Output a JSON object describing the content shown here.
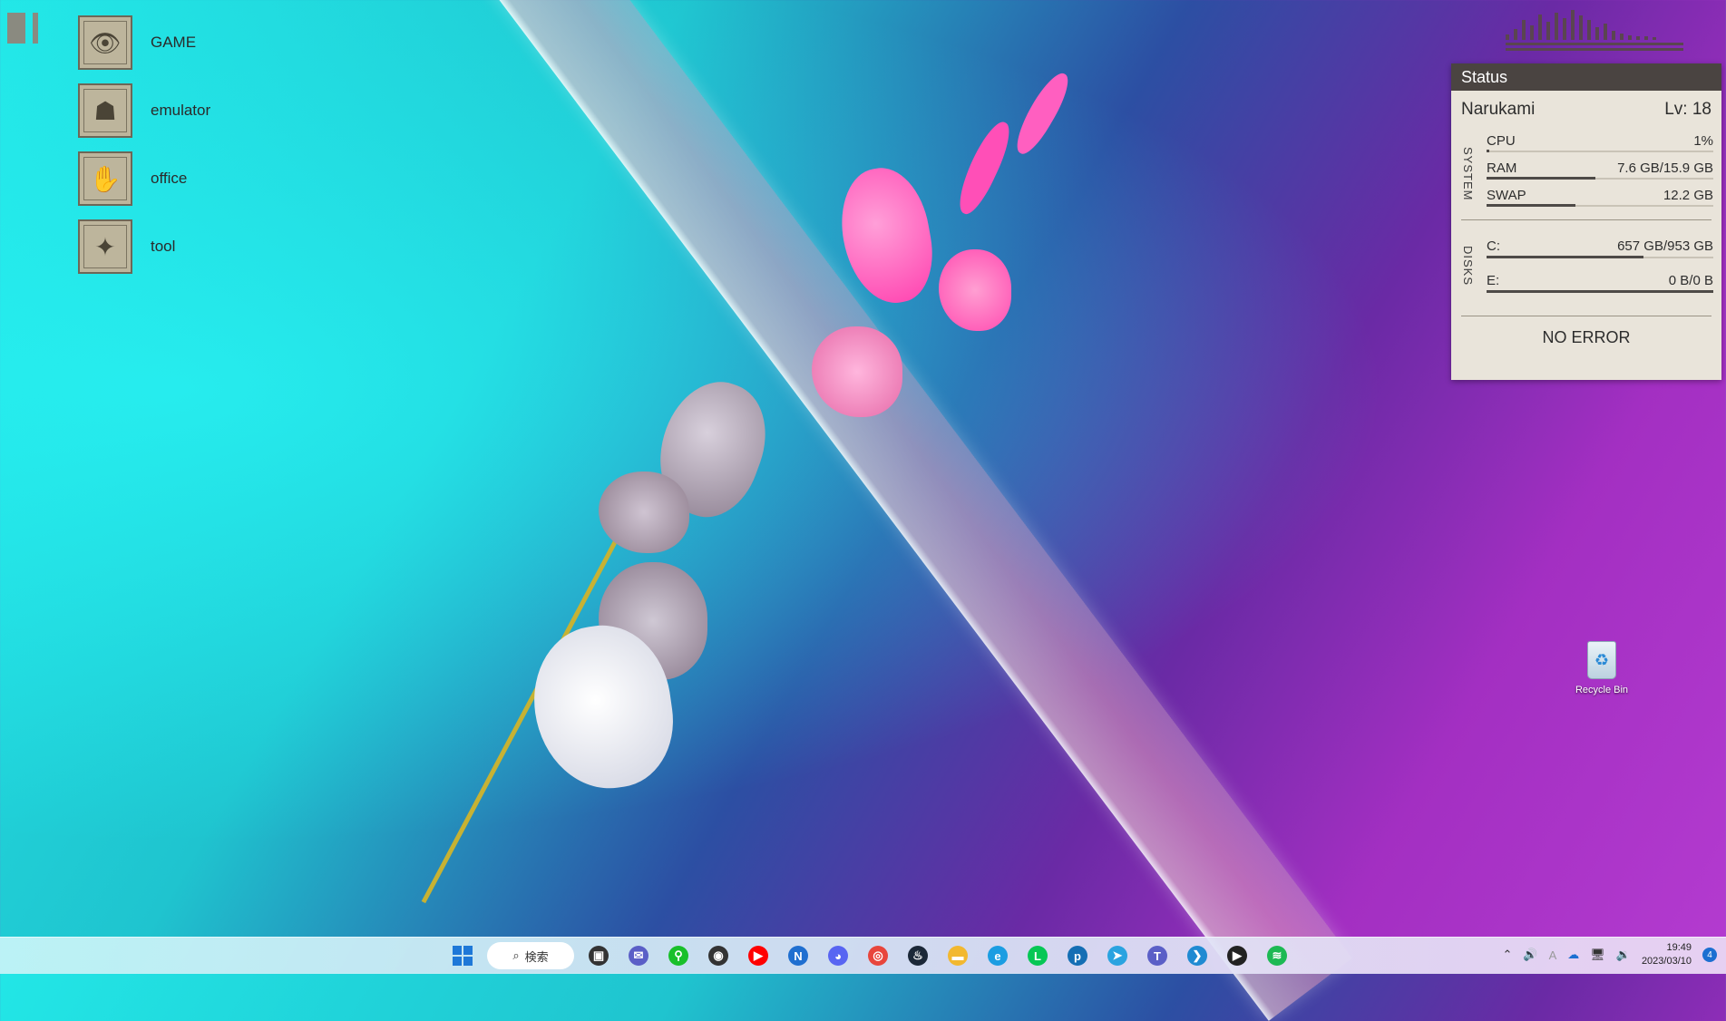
{
  "desktop": {
    "apps": [
      {
        "label": "GAME",
        "icon": "eye-icon",
        "glyph": "👁"
      },
      {
        "label": "emulator",
        "icon": "mask-icon",
        "glyph": "☗"
      },
      {
        "label": "office",
        "icon": "hands-icon",
        "glyph": "✋"
      },
      {
        "label": "tool",
        "icon": "star-icon",
        "glyph": "✦"
      }
    ],
    "recycle_bin_label": "Recycle Bin"
  },
  "status": {
    "title": "Status",
    "user": "Narukami",
    "level": "Lv: 18",
    "system_label": "SYSTEM",
    "system": [
      {
        "name": "CPU",
        "value": "1%",
        "fraction": 0.01
      },
      {
        "name": "RAM",
        "value": "7.6 GB/15.9 GB",
        "fraction": 0.48
      },
      {
        "name": "SWAP",
        "value": "12.2 GB",
        "fraction": 0.39
      }
    ],
    "disks_label": "DISKS",
    "disks": [
      {
        "name": "C:",
        "value": "657 GB/953 GB",
        "fraction": 0.69
      },
      {
        "name": "E:",
        "value": "0 B/0 B",
        "fraction": 1.0
      }
    ],
    "footer": "NO ERROR"
  },
  "taskbar": {
    "search_label": "検索",
    "apps": [
      {
        "name": "task-view-icon",
        "glyph": "▣",
        "color": "#333333"
      },
      {
        "name": "chat-icon",
        "glyph": "✉",
        "color": "#5b5fc7"
      },
      {
        "name": "razer-icon",
        "glyph": "⚲",
        "color": "#19c02a"
      },
      {
        "name": "obs-icon",
        "glyph": "◉",
        "color": "#333333"
      },
      {
        "name": "youtube-icon",
        "glyph": "▶",
        "color": "#ff0000"
      },
      {
        "name": "news-icon",
        "glyph": "N",
        "color": "#1f6fd0"
      },
      {
        "name": "discord-icon",
        "glyph": "◕",
        "color": "#5865f2"
      },
      {
        "name": "chrome-icon",
        "glyph": "◎",
        "color": "#e8453c"
      },
      {
        "name": "steam-icon",
        "glyph": "♨",
        "color": "#1b2838"
      },
      {
        "name": "file-explorer-icon",
        "glyph": "▬",
        "color": "#f2b830"
      },
      {
        "name": "edge-icon",
        "glyph": "e",
        "color": "#1b9de2"
      },
      {
        "name": "line-icon",
        "glyph": "L",
        "color": "#06c755"
      },
      {
        "name": "prime-video-icon",
        "glyph": "p",
        "color": "#146eb4"
      },
      {
        "name": "telegram-icon",
        "glyph": "➤",
        "color": "#2aa3e0"
      },
      {
        "name": "teams-icon",
        "glyph": "T",
        "color": "#5b5fc7"
      },
      {
        "name": "vscode-icon",
        "glyph": "❯",
        "color": "#1f8ad2"
      },
      {
        "name": "media-player-icon",
        "glyph": "▶",
        "color": "#222222"
      },
      {
        "name": "spotify-icon",
        "glyph": "≋",
        "color": "#1db954"
      }
    ],
    "tray": {
      "ime": "A",
      "time": "19:49",
      "date": "2023/03/10",
      "notifications": "4"
    }
  }
}
